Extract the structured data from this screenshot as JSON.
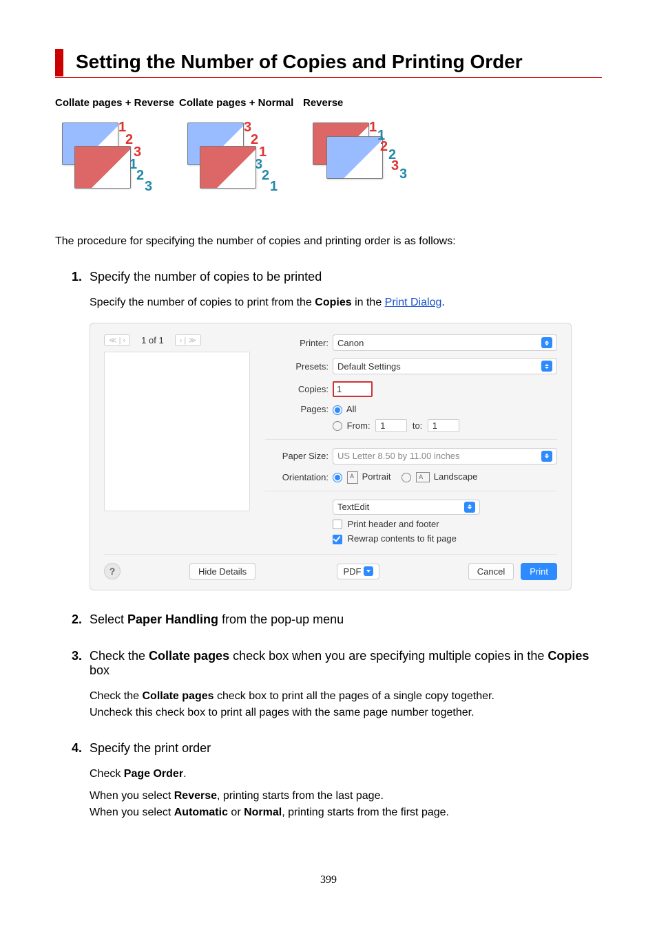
{
  "heading": "Setting the Number of Copies and Printing Order",
  "options": {
    "col1": "Collate pages + Reverse",
    "col2": "Collate pages + Normal",
    "col3": "Reverse"
  },
  "nums": {
    "n1": "1",
    "n2": "2",
    "n3": "3"
  },
  "lede": "The procedure for specifying the number of copies and printing order is as follows:",
  "steps": {
    "s1": {
      "title": "Specify the number of copies to be printed",
      "body_a": "Specify the number of copies to print from the ",
      "body_b_strong": "Copies",
      "body_c": " in the ",
      "link": "Print Dialog",
      "body_d": "."
    },
    "s2": {
      "title_a": "Select ",
      "title_b_strong": "Paper Handling",
      "title_c": " from the pop-up menu"
    },
    "s3": {
      "title_a": "Check the ",
      "title_b_strong": "Collate pages",
      "title_c": " check box when you are specifying multiple copies in the ",
      "title_d_strong": "Copies",
      "title_e": " box",
      "body_a": "Check the ",
      "body_b_strong": "Collate pages",
      "body_c": " check box to print all the pages of a single copy together.",
      "body2": "Uncheck this check box to print all pages with the same page number together."
    },
    "s4": {
      "title": "Specify the print order",
      "body_a": "Check ",
      "body_b_strong": "Page Order",
      "body_c": ".",
      "line2_a": "When you select ",
      "line2_b_strong": "Reverse",
      "line2_c": ", printing starts from the last page.",
      "line3_a": "When you select ",
      "line3_b_strong": "Automatic",
      "line3_c": " or ",
      "line3_d_strong": "Normal",
      "line3_e": ", printing starts from the first page."
    }
  },
  "dialog": {
    "pager": "1 of 1",
    "printer_label": "Printer:",
    "printer_value": "Canon",
    "presets_label": "Presets:",
    "presets_value": "Default Settings",
    "copies_label": "Copies:",
    "copies_value": "1",
    "pages_label": "Pages:",
    "pages_all": "All",
    "pages_from": "From:",
    "pages_from_val": "1",
    "pages_to": "to:",
    "pages_to_val": "1",
    "papersize_label": "Paper Size:",
    "papersize_value": "US Letter 8.50 by 11.00 inches",
    "orientation_label": "Orientation:",
    "orientation_portrait": "Portrait",
    "orientation_landscape": "Landscape",
    "panel_value": "TextEdit",
    "cb_header_footer": "Print header and footer",
    "cb_rewrap": "Rewrap contents to fit page",
    "help": "?",
    "hide_details": "Hide Details",
    "pdf": "PDF",
    "cancel": "Cancel",
    "print": "Print"
  },
  "page_number": "399"
}
